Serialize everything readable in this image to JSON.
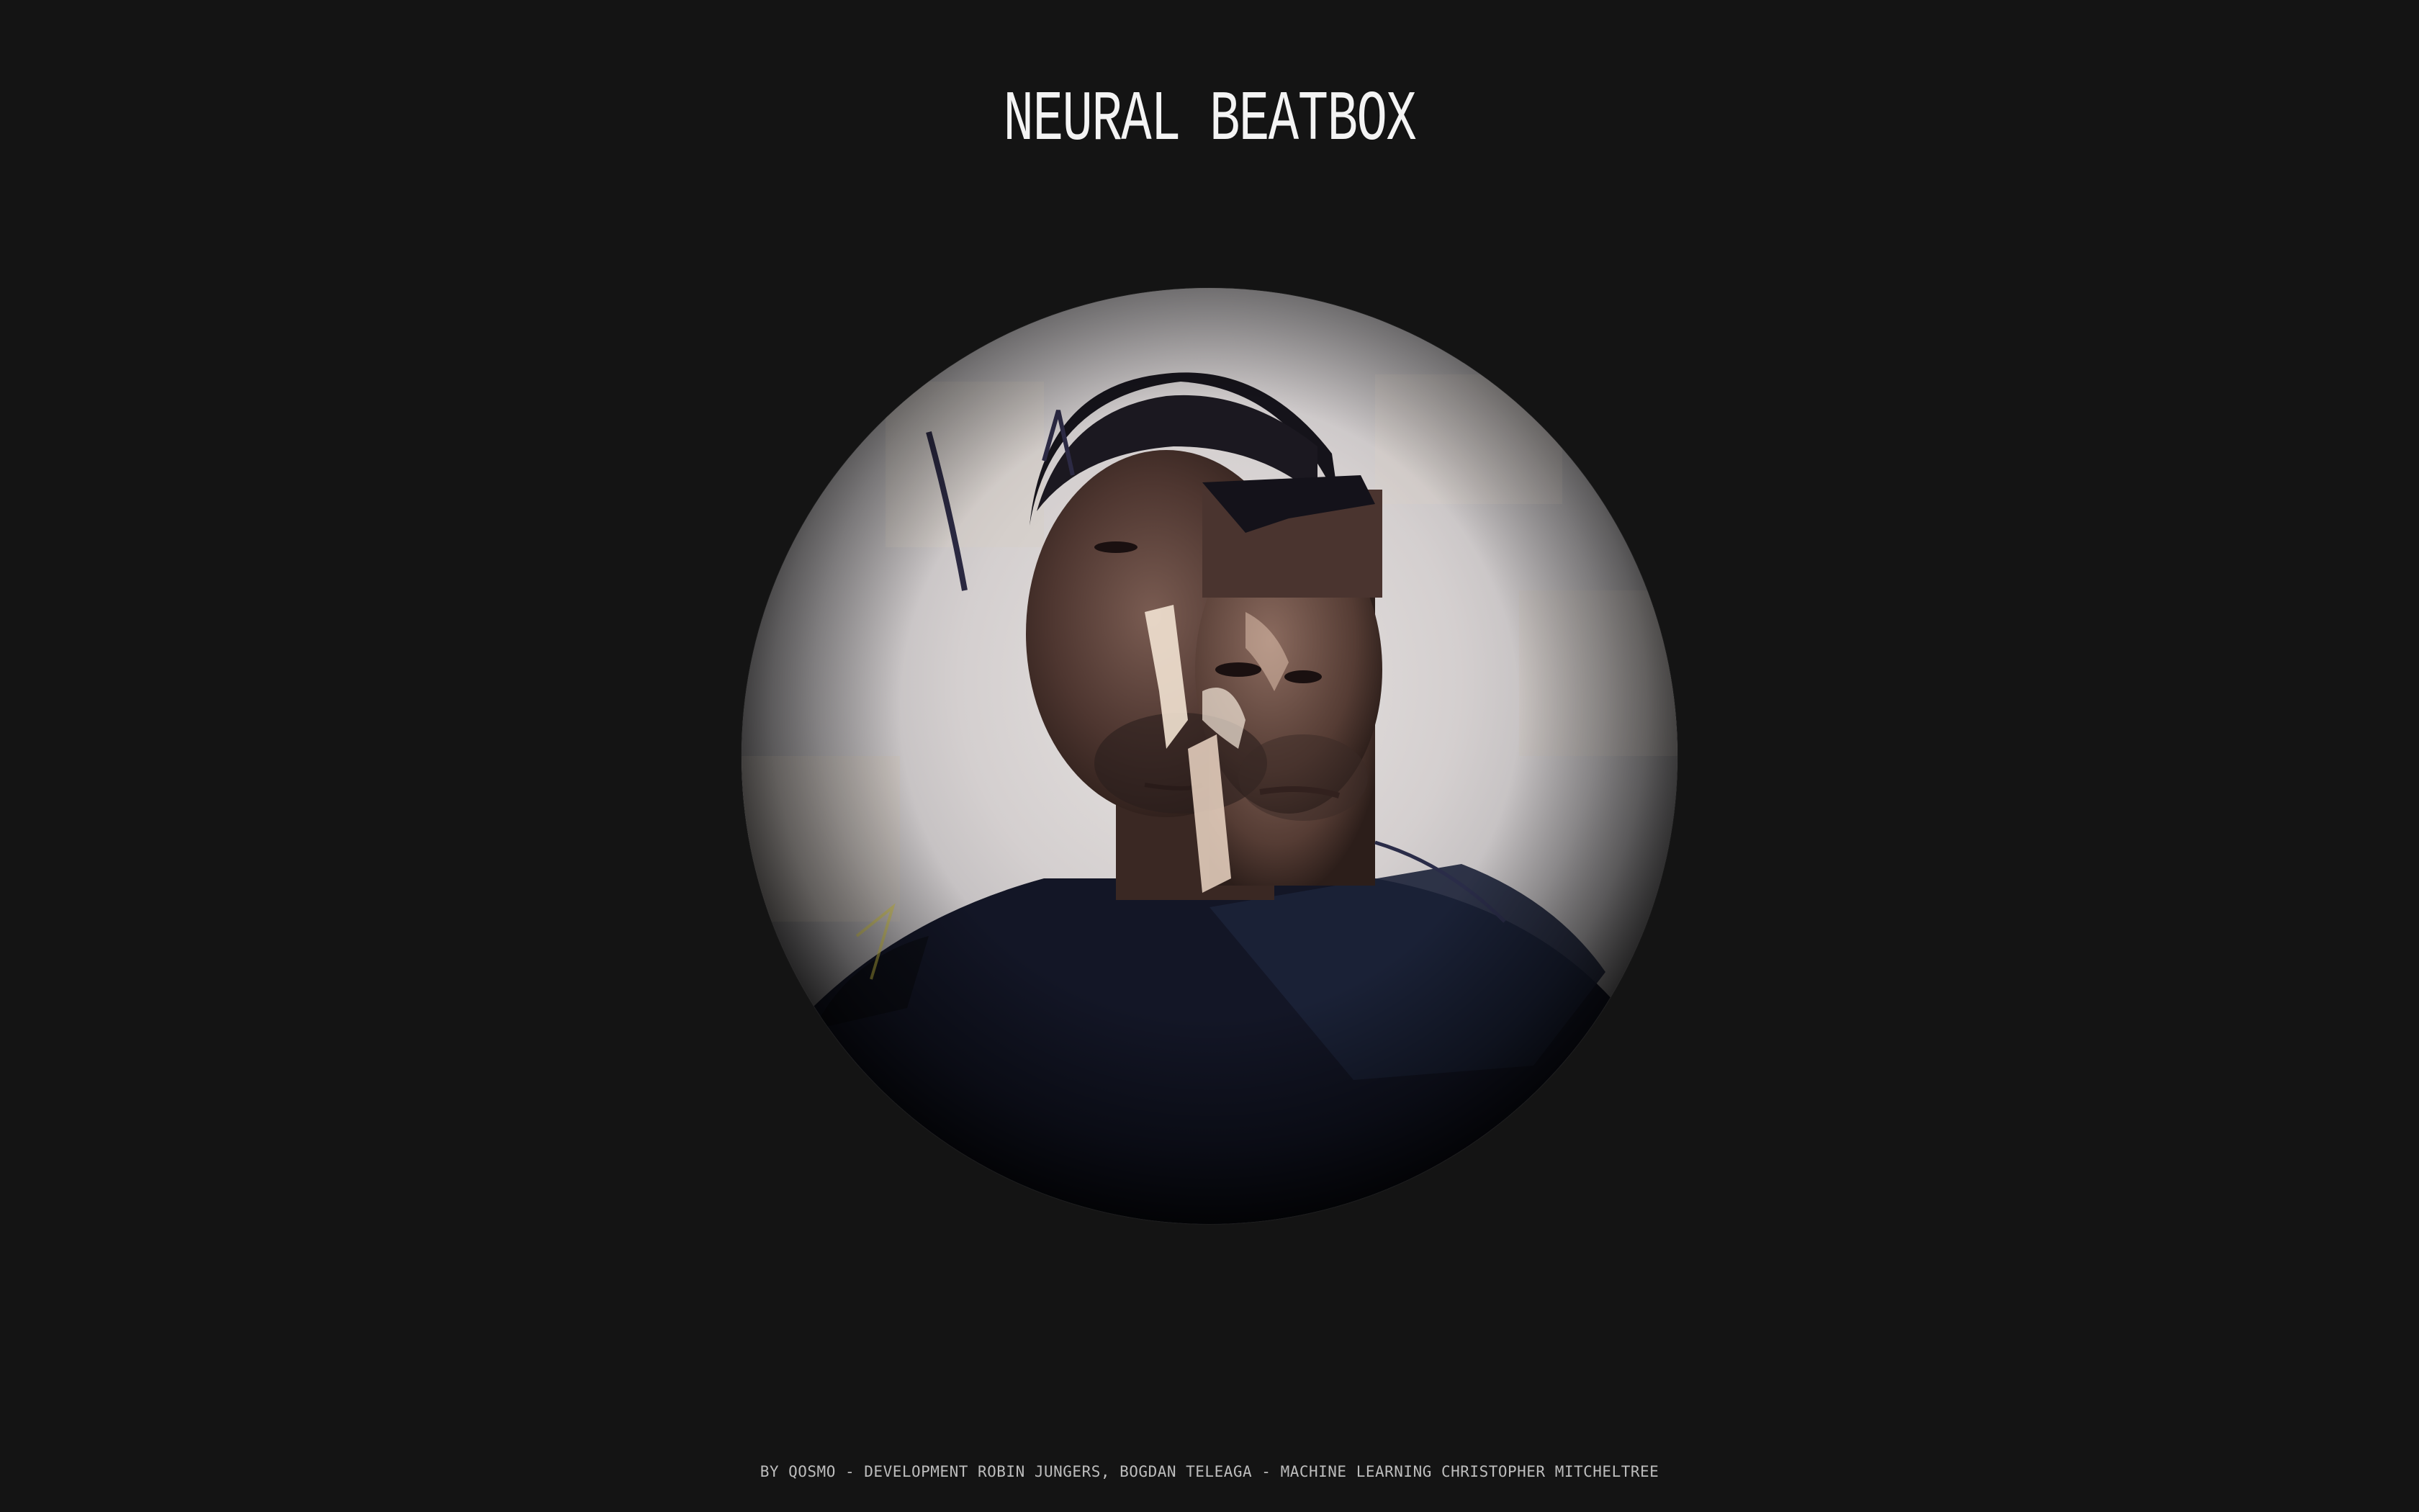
{
  "app": {
    "title": "NEURAL BEATBOX"
  },
  "camera": {
    "icon": "webcam-feed"
  },
  "footer": {
    "credits": "BY QOSMO - DEVELOPMENT ROBIN JUNGERS, BOGDAN TELEAGA - MACHINE LEARNING CHRISTOPHER MITCHELTREE"
  },
  "colors": {
    "background": "#141414",
    "title": "#f4f4f4",
    "credits": "#bdbdbd"
  }
}
